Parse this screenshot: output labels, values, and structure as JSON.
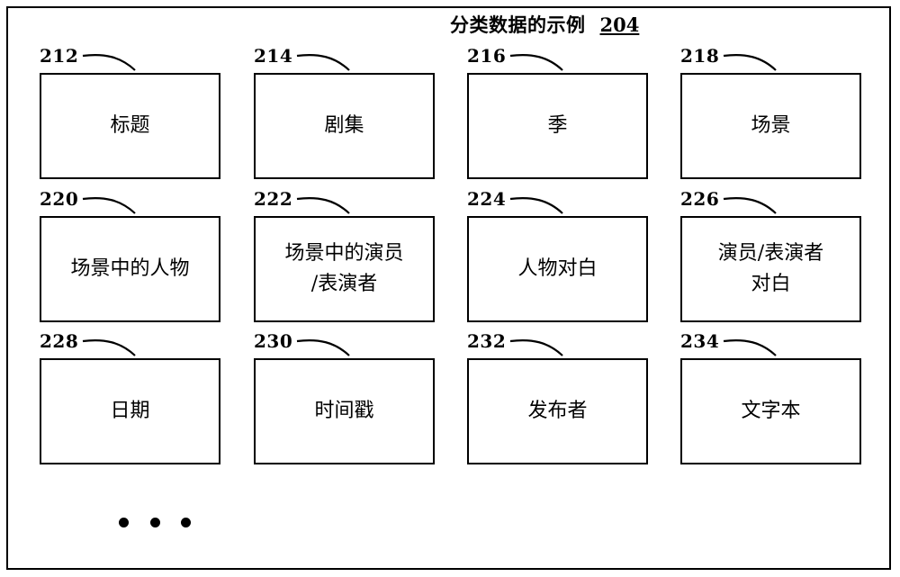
{
  "figure": {
    "caption_text": "分类数据的示例",
    "caption_number": "204"
  },
  "boxes": [
    {
      "ref": "212",
      "label": "标题",
      "col": 0,
      "row": 0
    },
    {
      "ref": "214",
      "label": "剧集",
      "col": 1,
      "row": 0
    },
    {
      "ref": "216",
      "label": "季",
      "col": 2,
      "row": 0
    },
    {
      "ref": "218",
      "label": "场景",
      "col": 3,
      "row": 0
    },
    {
      "ref": "220",
      "label": "场景中的人物",
      "col": 0,
      "row": 1
    },
    {
      "ref": "222",
      "label": "场景中的演员\n/表演者",
      "col": 1,
      "row": 1
    },
    {
      "ref": "224",
      "label": "人物对白",
      "col": 2,
      "row": 1
    },
    {
      "ref": "226",
      "label": "演员/表演者\n对白",
      "col": 3,
      "row": 1
    },
    {
      "ref": "228",
      "label": "日期",
      "col": 0,
      "row": 2
    },
    {
      "ref": "230",
      "label": "时间戳",
      "col": 1,
      "row": 2
    },
    {
      "ref": "232",
      "label": "发布者",
      "col": 2,
      "row": 2
    },
    {
      "ref": "234",
      "label": "文字本",
      "col": 3,
      "row": 2
    }
  ],
  "ellipsis": {
    "dots": [
      "dot",
      "dot",
      "dot"
    ]
  },
  "colors": {
    "stroke": "#000000",
    "background": "#ffffff"
  }
}
